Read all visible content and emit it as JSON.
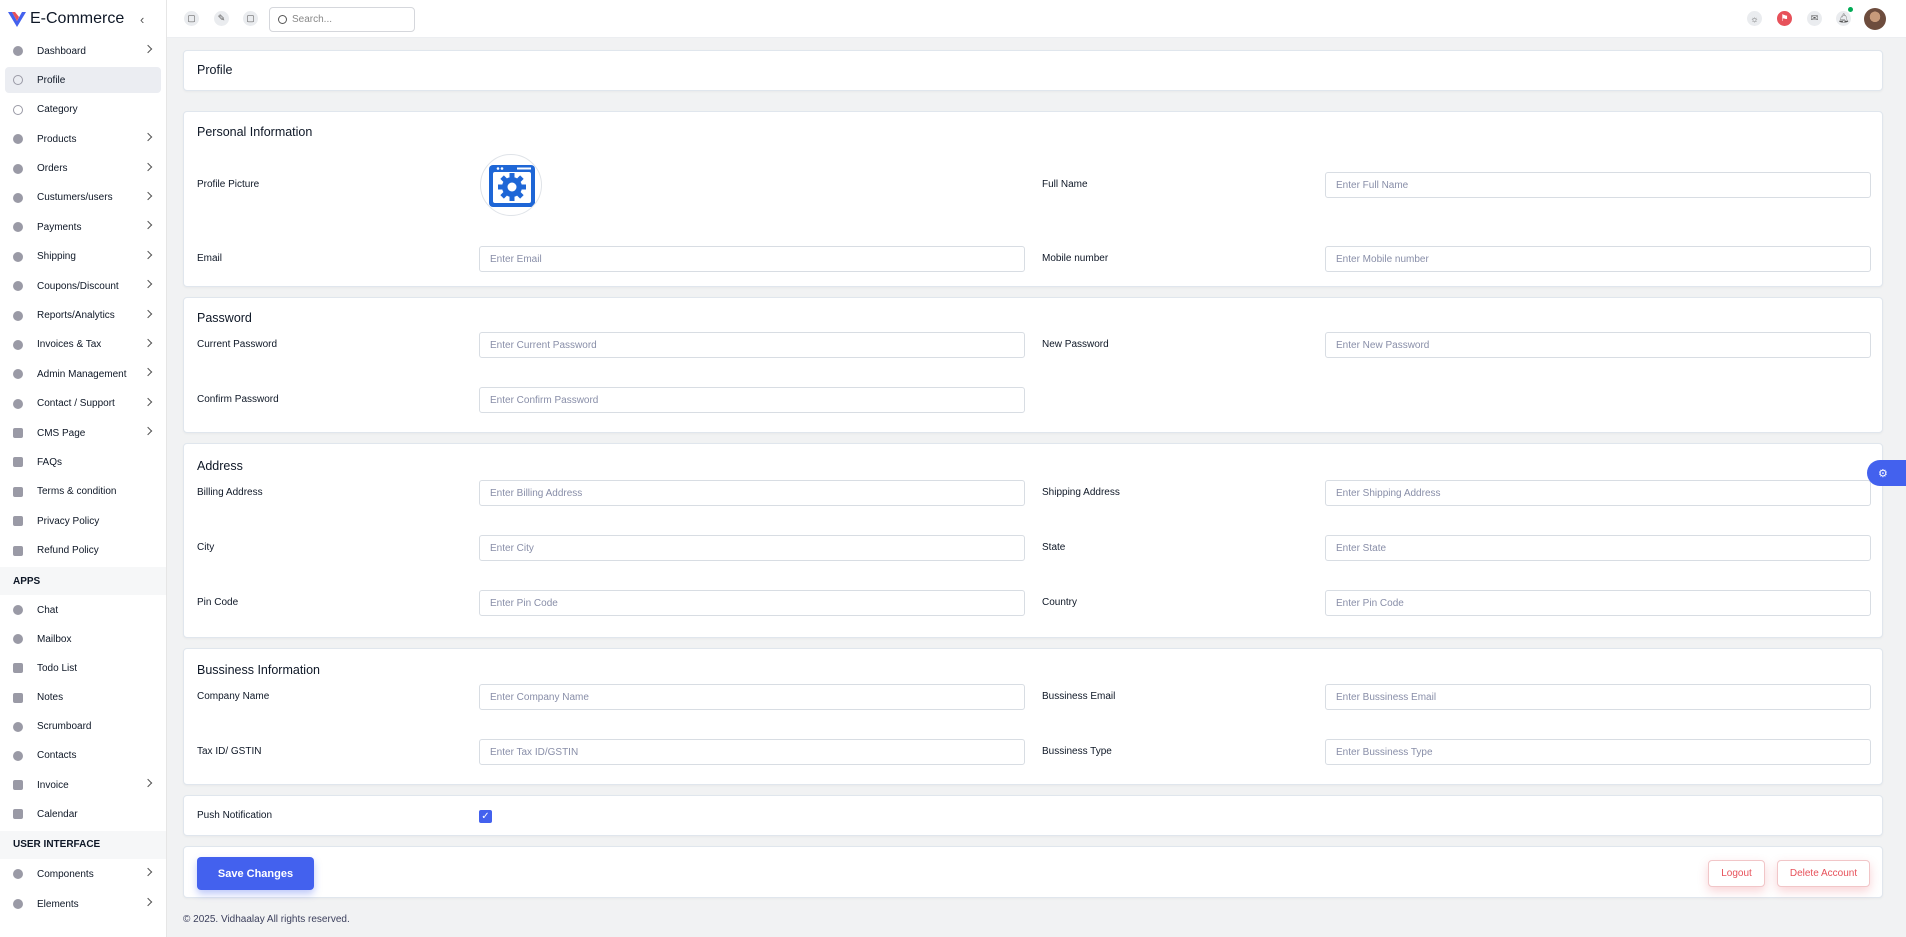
{
  "app": {
    "title": "E-Commerce"
  },
  "sidebar": {
    "items": [
      {
        "label": "Dashboard",
        "icon": "home-icon",
        "chevron": true
      },
      {
        "label": "Profile",
        "icon": "user-icon",
        "chevron": false,
        "active": true
      },
      {
        "label": "Category",
        "icon": "user-icon",
        "chevron": false
      },
      {
        "label": "Products",
        "icon": "dollar-icon",
        "chevron": true
      },
      {
        "label": "Orders",
        "icon": "dollar-icon",
        "chevron": true
      },
      {
        "label": "Custumers/users",
        "icon": "dollar-icon",
        "chevron": true
      },
      {
        "label": "Payments",
        "icon": "dollar-icon",
        "chevron": true
      },
      {
        "label": "Shipping",
        "icon": "dollar-icon",
        "chevron": true
      },
      {
        "label": "Coupons/Discount",
        "icon": "dollar-icon",
        "chevron": true
      },
      {
        "label": "Reports/Analytics",
        "icon": "dollar-icon",
        "chevron": true
      },
      {
        "label": "Invoices & Tax",
        "icon": "dollar-icon",
        "chevron": true
      },
      {
        "label": "Admin Management",
        "icon": "dollar-icon",
        "chevron": true
      },
      {
        "label": "Contact / Support",
        "icon": "dollar-icon",
        "chevron": true
      },
      {
        "label": "CMS Page",
        "icon": "page-icon",
        "chevron": true
      },
      {
        "label": "FAQs",
        "icon": "document-icon",
        "chevron": false
      },
      {
        "label": "Terms & condition",
        "icon": "document-icon",
        "chevron": false
      },
      {
        "label": "Privacy Policy",
        "icon": "document-icon",
        "chevron": false
      },
      {
        "label": "Refund Policy",
        "icon": "document-icon",
        "chevron": false
      }
    ],
    "apps_heading": "APPS",
    "apps": [
      {
        "label": "Chat",
        "icon": "chat-icon",
        "chevron": false
      },
      {
        "label": "Mailbox",
        "icon": "mail-icon",
        "chevron": false
      },
      {
        "label": "Todo List",
        "icon": "todo-icon",
        "chevron": false
      },
      {
        "label": "Notes",
        "icon": "notes-icon",
        "chevron": false
      },
      {
        "label": "Scrumboard",
        "icon": "board-icon",
        "chevron": false
      },
      {
        "label": "Contacts",
        "icon": "contacts-icon",
        "chevron": false
      },
      {
        "label": "Invoice",
        "icon": "invoice-icon",
        "chevron": true
      },
      {
        "label": "Calendar",
        "icon": "calendar-icon",
        "chevron": false
      }
    ],
    "ui_heading": "USER INTERFACE",
    "ui": [
      {
        "label": "Components",
        "icon": "cube-icon",
        "chevron": true
      },
      {
        "label": "Elements",
        "icon": "bolt-icon",
        "chevron": true
      }
    ]
  },
  "topbar": {
    "search_placeholder": "Search..."
  },
  "page": {
    "title": "Profile"
  },
  "personal": {
    "title": "Personal Information",
    "profile_picture_label": "Profile Picture",
    "full_name_label": "Full Name",
    "full_name_placeholder": "Enter Full Name",
    "email_label": "Email",
    "email_placeholder": "Enter Email",
    "mobile_label": "Mobile number",
    "mobile_placeholder": "Enter Mobile number"
  },
  "password": {
    "title": "Password",
    "current_label": "Current Password",
    "current_placeholder": "Enter Current Password",
    "new_label": "New Password",
    "new_placeholder": "Enter New Password",
    "confirm_label": "Confirm Password",
    "confirm_placeholder": "Enter Confirm Password"
  },
  "address": {
    "title": "Address",
    "billing_label": "Billing Address",
    "billing_placeholder": "Enter Billing Address",
    "shipping_label": "Shipping Address",
    "shipping_placeholder": "Enter Shipping Address",
    "city_label": "City",
    "city_placeholder": "Enter City",
    "state_label": "State",
    "state_placeholder": "Enter State",
    "pin_label": "Pin Code",
    "pin_placeholder": "Enter Pin Code",
    "country_label": "Country",
    "country_placeholder": "Enter Pin Code"
  },
  "business": {
    "title": "Bussiness Information",
    "company_label": "Company Name",
    "company_placeholder": "Enter Company Name",
    "email_label": "Bussiness Email",
    "email_placeholder": "Enter Bussiness Email",
    "tax_label": "Tax ID/ GSTIN",
    "tax_placeholder": "Enter Tax ID/GSTIN",
    "type_label": "Bussiness Type",
    "type_placeholder": "Enter Bussiness Type"
  },
  "notification": {
    "label": "Push Notification",
    "checked": true
  },
  "actions": {
    "save": "Save Changes",
    "logout": "Logout",
    "delete": "Delete Account"
  },
  "footer": {
    "text": "© 2025. Vidhaalay All rights reserved."
  },
  "colors": {
    "primary": "#4361ee",
    "danger": "#e7515a"
  }
}
